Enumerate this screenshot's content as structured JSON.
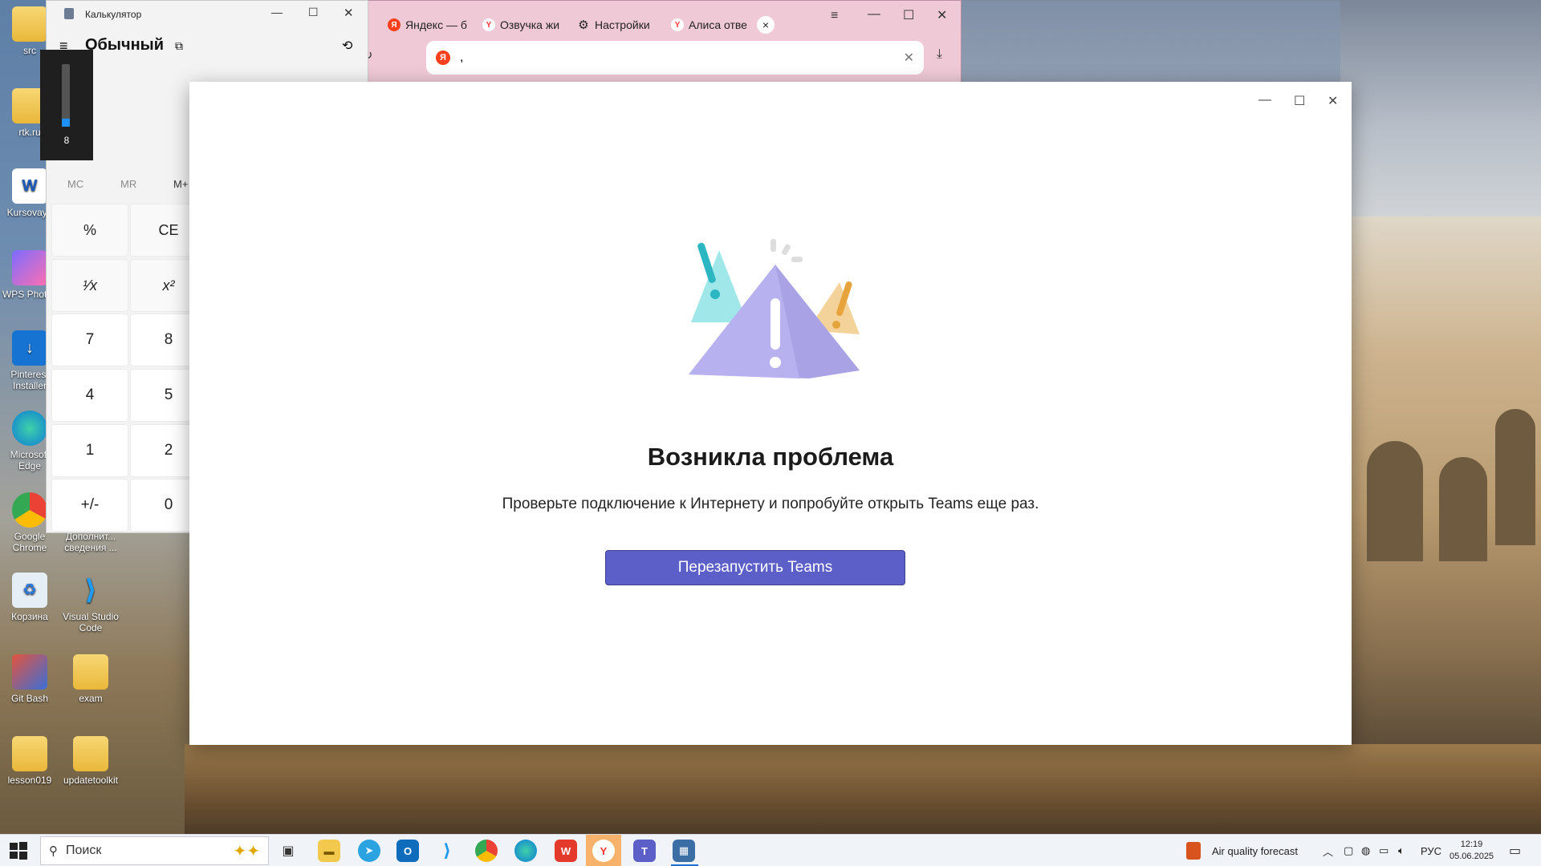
{
  "desktop": {
    "icons": [
      {
        "label": "src"
      },
      {
        "label": "rtk.ru"
      },
      {
        "label": "Kursovaya"
      },
      {
        "label": "WPS Photos"
      },
      {
        "label": "Pinterest Installer"
      },
      {
        "label": "Microsoft Edge"
      },
      {
        "label": "Google Chrome"
      },
      {
        "label": "Дополнит... сведения ..."
      },
      {
        "label": "Корзина"
      },
      {
        "label": "Visual Studio Code"
      },
      {
        "label": "Git Bash"
      },
      {
        "label": "exam"
      },
      {
        "label": "lesson019"
      },
      {
        "label": "updatetoolkit"
      }
    ]
  },
  "calculator": {
    "title": "Калькулятор",
    "mode": "Обычный",
    "memory": [
      "MC",
      "MR",
      "M+"
    ],
    "keys": [
      "%",
      "CE",
      "¹⁄x",
      "x²",
      "7",
      "8",
      "4",
      "5",
      "1",
      "2",
      "+/-",
      "0"
    ]
  },
  "volume": {
    "level": 8
  },
  "browser": {
    "tabs": [
      {
        "label": "Яндекс — б",
        "icon": "yandex-icon"
      },
      {
        "label": "Озвучка жи",
        "icon": "yandex-browser-icon"
      },
      {
        "label": "Настройки",
        "icon": "gear-icon"
      },
      {
        "label": "Алиса отве",
        "icon": "yandex-browser-icon"
      }
    ],
    "address": ","
  },
  "teams": {
    "title": "Возникла проблема",
    "message": "Проверьте подключение к Интернету и попробуйте открыть Teams еще раз.",
    "button": "Перезапустить Teams",
    "accent": "#5b5fc7"
  },
  "taskbar": {
    "search_placeholder": "Поиск",
    "weather": "Air quality forecast",
    "lang": "РУС",
    "time": "12:19",
    "date": "05.06.2025"
  }
}
